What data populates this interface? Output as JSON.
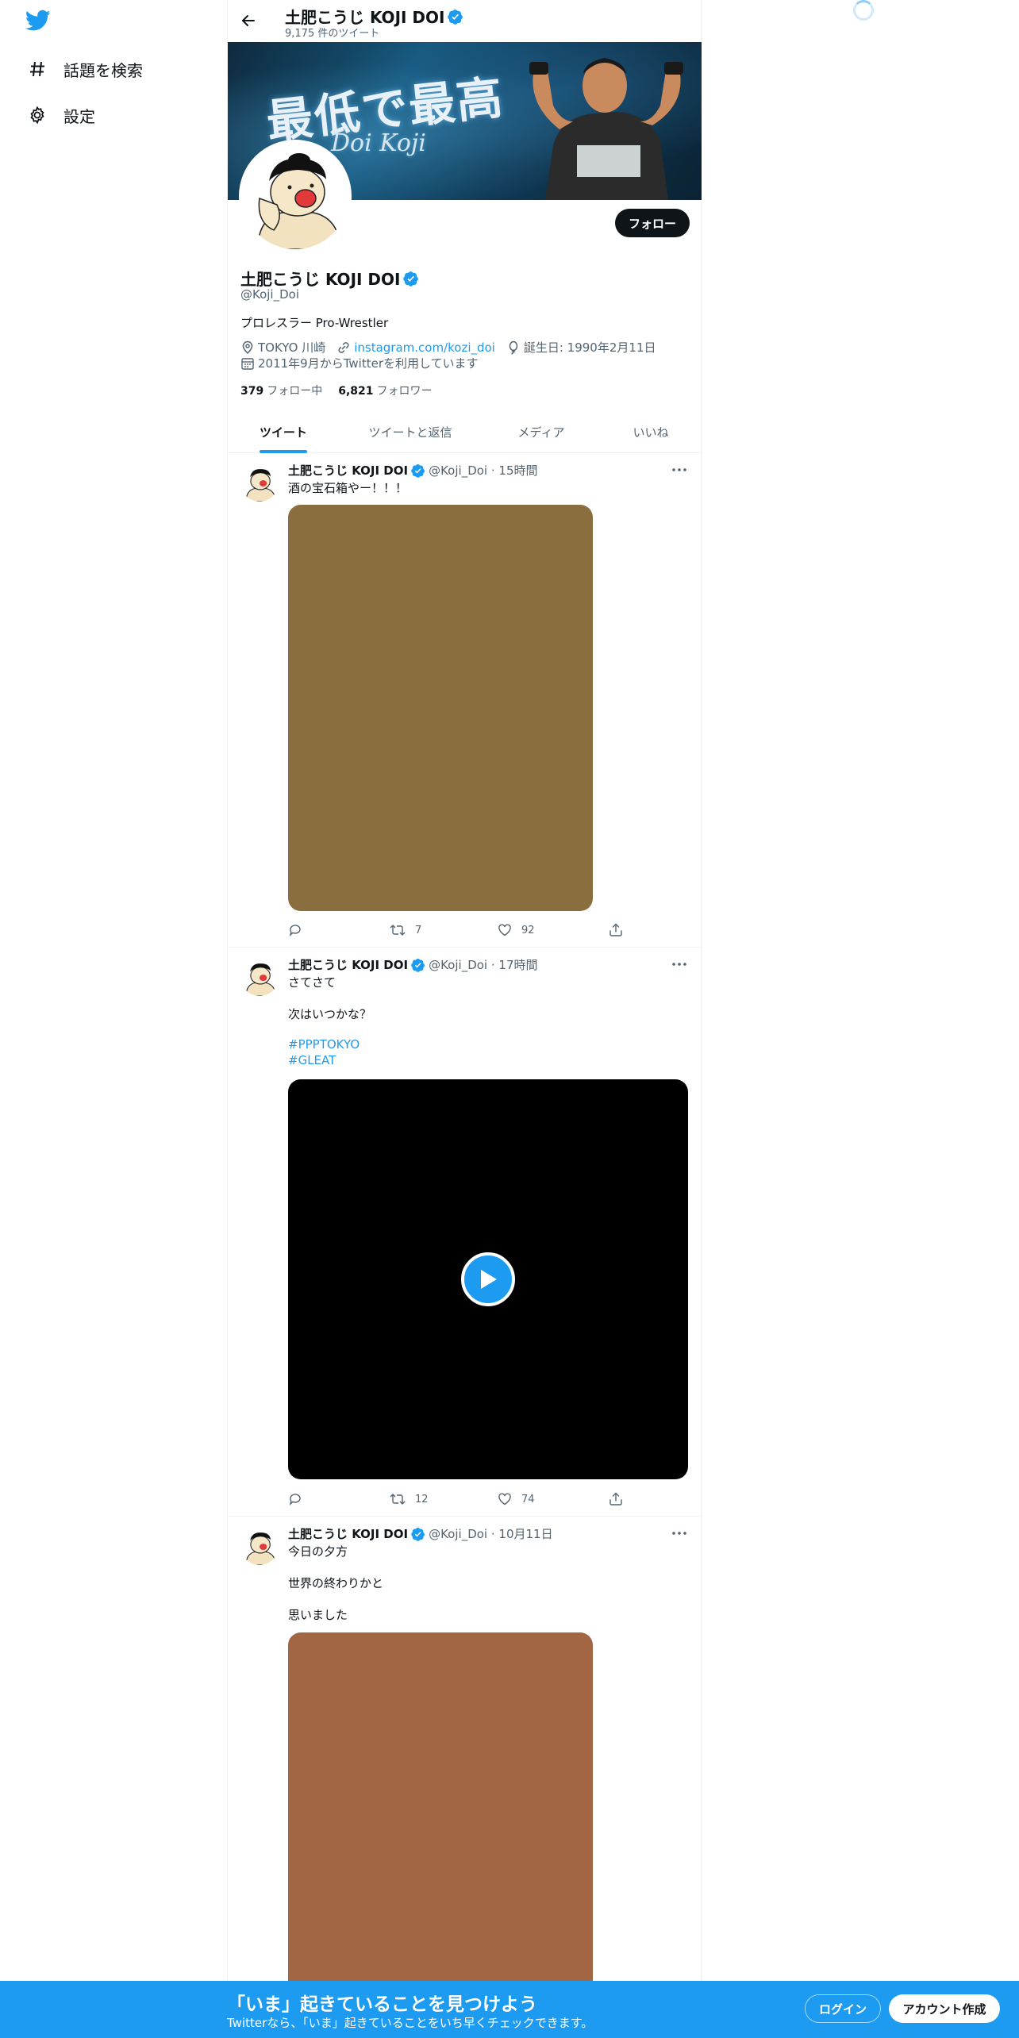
{
  "nav": {
    "explore_label": "話題を検索",
    "settings_label": "設定"
  },
  "header": {
    "name": "土肥こうじ KOJI DOI",
    "tweet_count": "9,175 件のツイート"
  },
  "banner": {
    "title_text": "最低で最高",
    "subtitle_text": "Doi Koji"
  },
  "profile": {
    "name": "土肥こうじ KOJI DOI",
    "handle": "@Koji_Doi",
    "bio": "プロレスラー Pro-Wrestler",
    "location": "TOKYO 川崎",
    "link": "instagram.com/kozi_doi",
    "birthday": "誕生日: 1990年2月11日",
    "joined": "2011年9月からTwitterを利用しています",
    "following_count": "379",
    "following_label": "フォロー中",
    "followers_count": "6,821",
    "followers_label": "フォロワー",
    "follow_button": "フォロー"
  },
  "tabs": [
    {
      "label": "ツイート",
      "active": true
    },
    {
      "label": "ツイートと返信",
      "active": false
    },
    {
      "label": "メディア",
      "active": false
    },
    {
      "label": "いいね",
      "active": false
    }
  ],
  "tweets": [
    {
      "name": "土肥こうじ KOJI DOI",
      "handle": "@Koji_Doi",
      "time": "15時間",
      "lines": [
        "酒の宝石箱やー！！！"
      ],
      "media": {
        "type": "image",
        "color": "#8a6e3e"
      },
      "reply": "",
      "retweets": "7",
      "likes": "92"
    },
    {
      "name": "土肥こうじ KOJI DOI",
      "handle": "@Koji_Doi",
      "time": "17時間",
      "lines": [
        "さてさて",
        "次はいつかな？"
      ],
      "hashtags": [
        "#PPPTOKYO",
        "#GLEAT"
      ],
      "media": {
        "type": "video",
        "color": "#000000"
      },
      "reply": "",
      "retweets": "12",
      "likes": "74"
    },
    {
      "name": "土肥こうじ KOJI DOI",
      "handle": "@Koji_Doi",
      "time": "10月11日",
      "lines": [
        "今日の夕方",
        "世界の終わりかと",
        "思いました"
      ],
      "media": {
        "type": "image",
        "color": "#a36642"
      }
    }
  ],
  "bottom_bar": {
    "title": "「いま」起きていることを見つけよう",
    "subtitle": "Twitterなら、「いま」起きていることをいち早くチェックできます。",
    "login": "ログイン",
    "signup": "アカウント作成"
  },
  "colors": {
    "accent": "#1d9bf0",
    "bottom_bar": "#1d9bf0",
    "text_primary": "#0f1419",
    "text_secondary": "#536471"
  }
}
